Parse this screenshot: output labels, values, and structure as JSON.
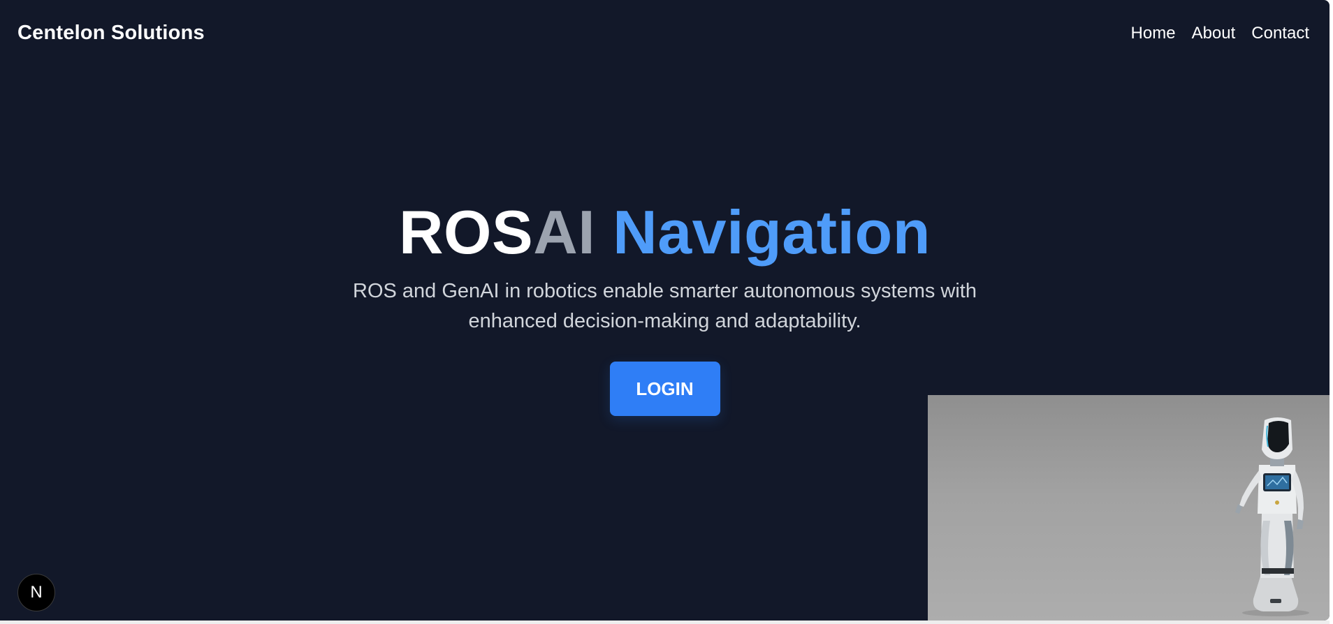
{
  "header": {
    "brand": "Centelon Solutions",
    "nav": [
      "Home",
      "About",
      "Contact"
    ]
  },
  "hero": {
    "title_part1": "ROS",
    "title_part2": "AI",
    "title_part3": "Navigation",
    "subtitle": "ROS and GenAI in robotics enable smarter autonomous systems with enhanced decision-making and adaptability.",
    "login_label": "LOGIN"
  },
  "badge": {
    "letter": "N"
  },
  "colors": {
    "background": "#121829",
    "accent": "#2f7ef6",
    "title_blue": "#4f9cf9",
    "title_gray": "#9ca3af"
  }
}
